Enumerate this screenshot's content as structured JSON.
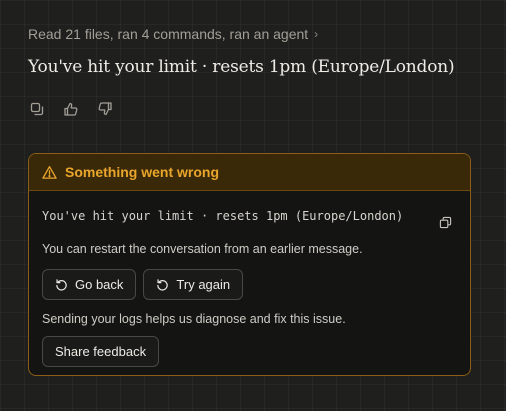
{
  "summary": {
    "text": "Read 21 files, ran 4 commands, ran an agent",
    "chevron": "›"
  },
  "message": {
    "text": "You've hit your limit · resets 1pm (Europe/London)"
  },
  "message_actions": [
    {
      "icon": "copy-icon"
    },
    {
      "icon": "thumbs-up-icon"
    },
    {
      "icon": "thumbs-down-icon"
    }
  ],
  "error_card": {
    "title": "Something went wrong",
    "warning_icon": "warning-triangle-icon",
    "code": "You've hit your limit · resets 1pm (Europe/London)",
    "restart_text": "You can restart the conversation from an earlier message.",
    "go_back_label": "Go back",
    "try_again_label": "Try again",
    "logs_text": "Sending your logs helps us diagnose and fix this issue.",
    "feedback_label": "Share feedback"
  },
  "colors": {
    "background": "#1f1f1e",
    "warning_accent": "#e9a52c",
    "warning_header_bg": "#3a2908",
    "card_border": "#8a5e16"
  }
}
